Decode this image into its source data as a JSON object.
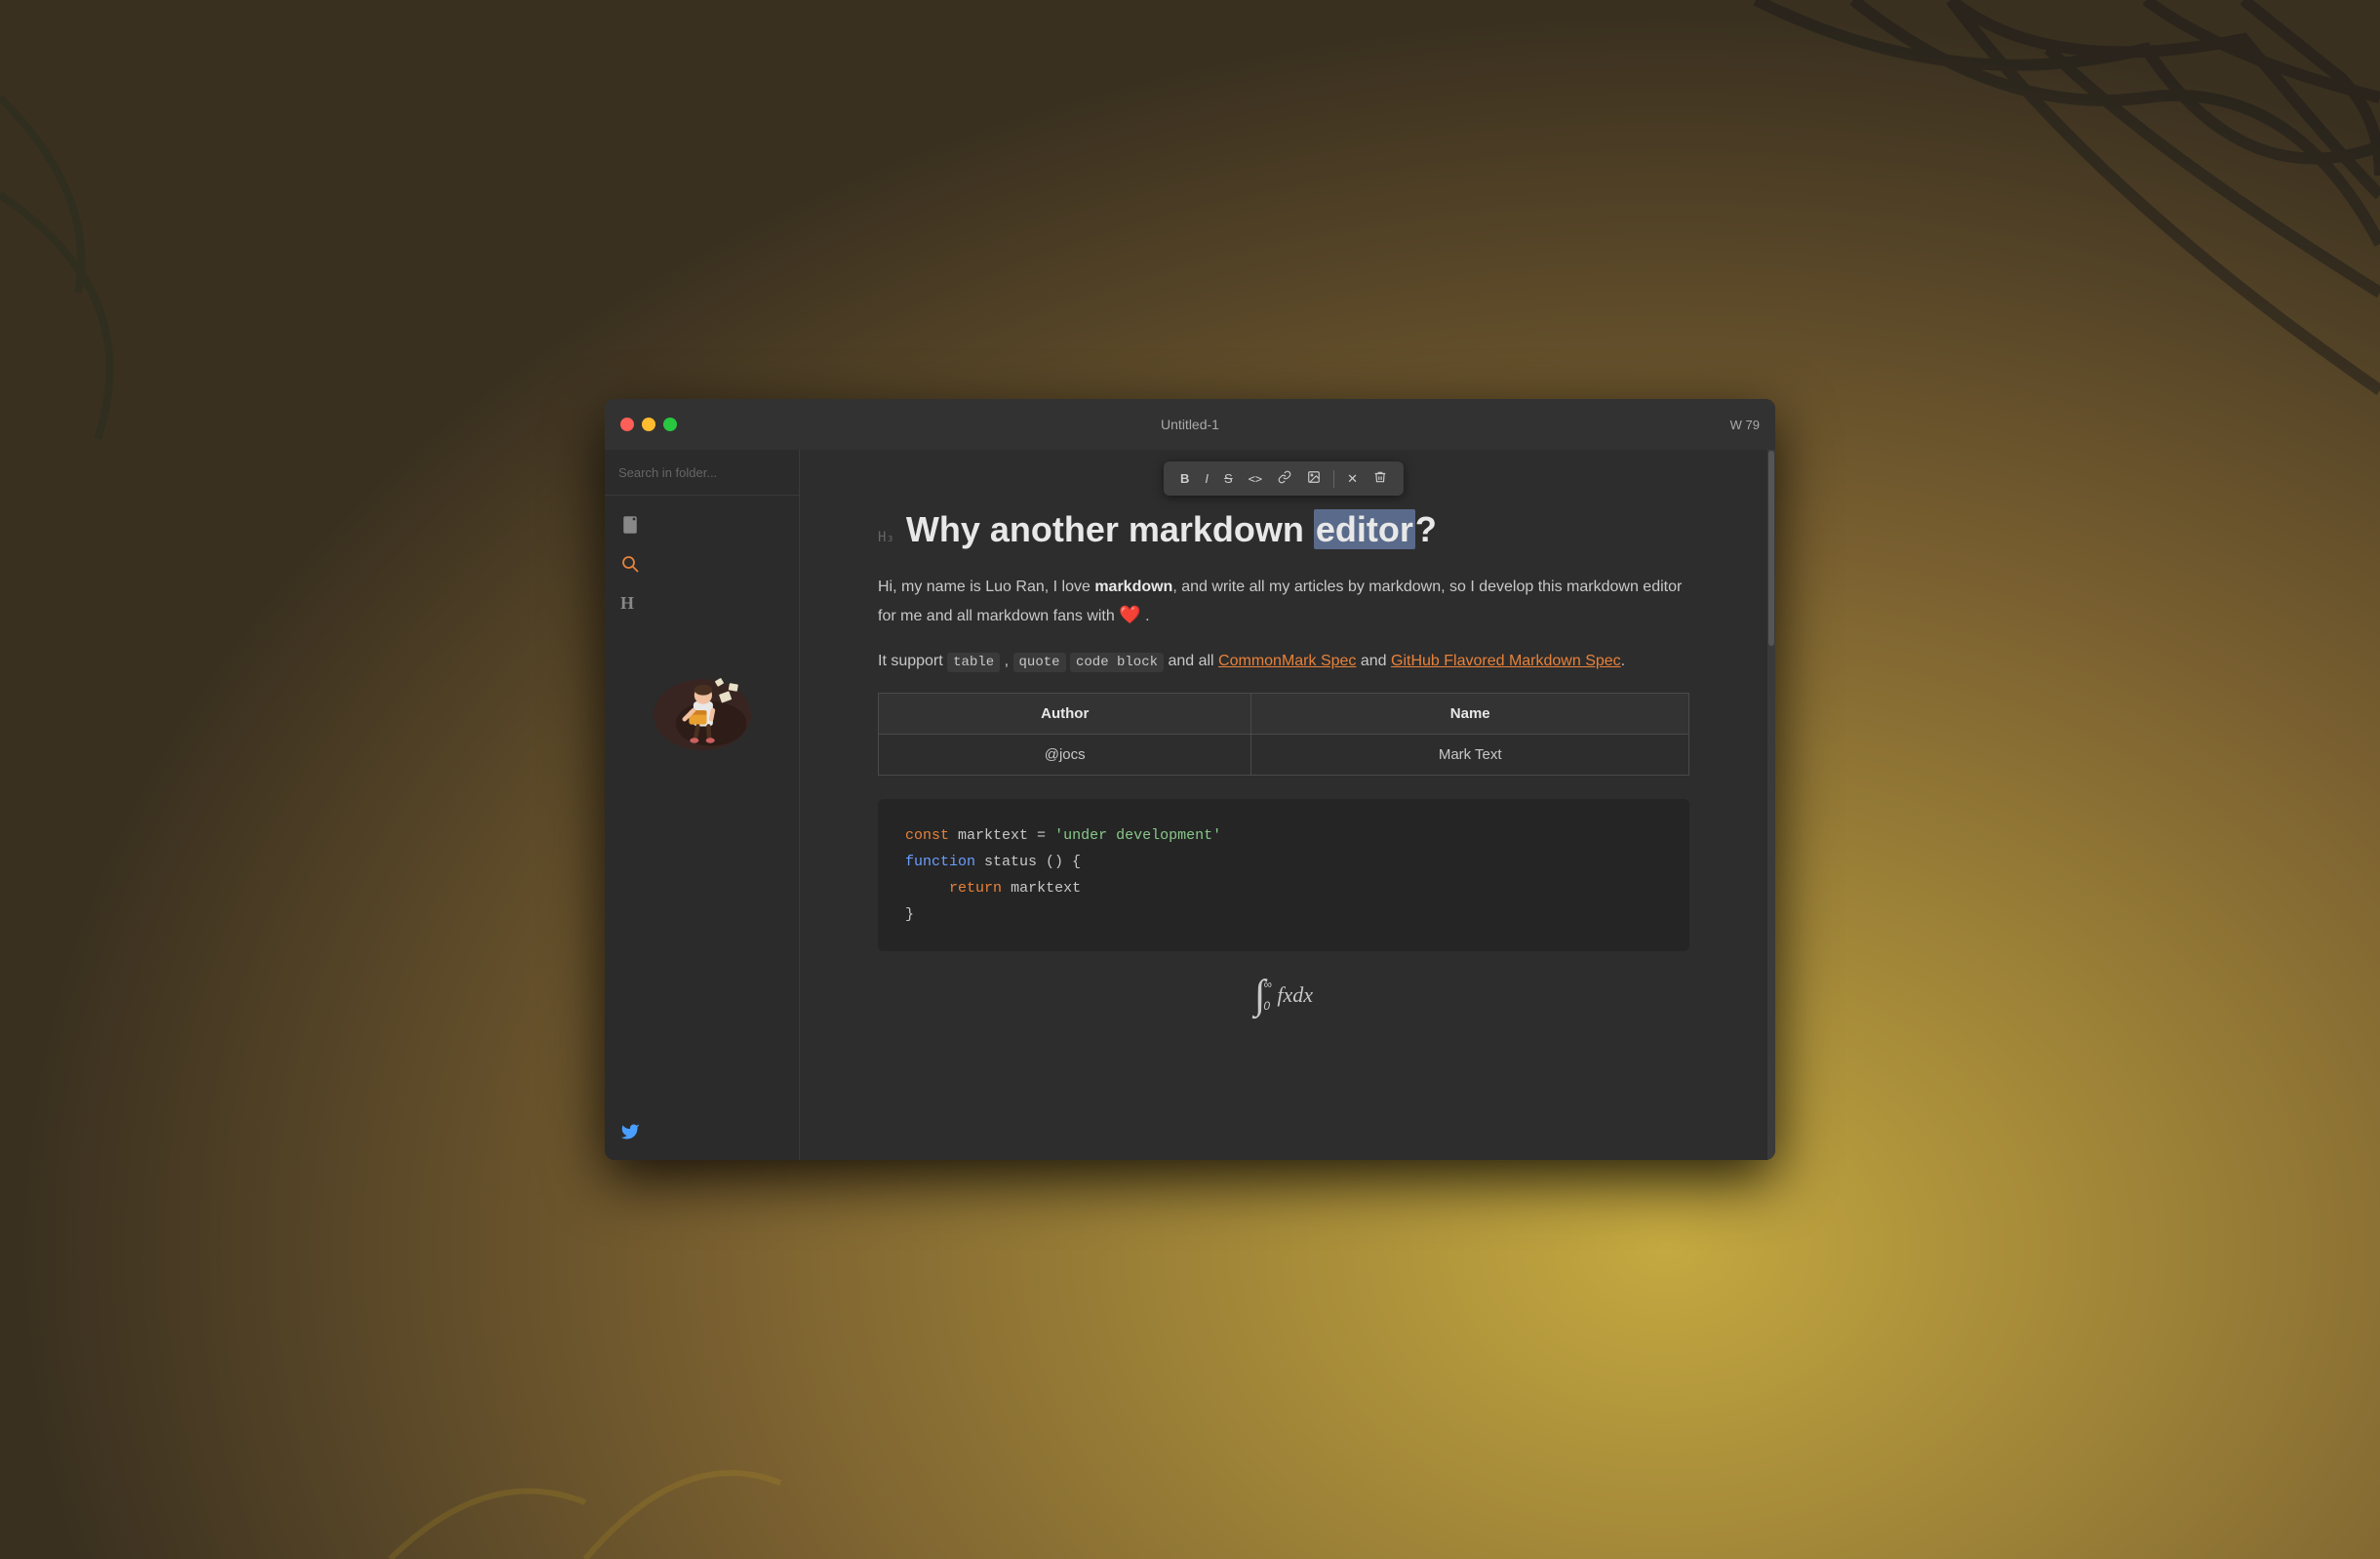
{
  "window": {
    "title": "Untitled-1",
    "word_count": "W 79",
    "traffic_lights": [
      "close",
      "minimize",
      "maximize"
    ]
  },
  "sidebar": {
    "search_placeholder": "Search in folder...",
    "nav_items": [
      {
        "id": "files",
        "icon": "📄",
        "label": "Files",
        "active": false
      },
      {
        "id": "search",
        "icon": "🔍",
        "label": "Search",
        "active": true
      },
      {
        "id": "headings",
        "icon": "H",
        "label": "Headings",
        "active": false
      }
    ],
    "twitter_icon": "🐦"
  },
  "toolbar": {
    "buttons": [
      {
        "id": "bold",
        "label": "B",
        "tooltip": "Bold"
      },
      {
        "id": "italic",
        "label": "I",
        "tooltip": "Italic"
      },
      {
        "id": "strikethrough",
        "label": "S̶",
        "tooltip": "Strikethrough"
      },
      {
        "id": "code-inline",
        "label": "<>",
        "tooltip": "Inline Code"
      },
      {
        "id": "link",
        "label": "🔗",
        "tooltip": "Link"
      },
      {
        "id": "image",
        "label": "🖼",
        "tooltip": "Image"
      },
      {
        "id": "remove",
        "label": "✕",
        "tooltip": "Remove"
      },
      {
        "id": "erase",
        "label": "◊",
        "tooltip": "Erase"
      }
    ]
  },
  "editor": {
    "heading_label": "H3",
    "heading_text_before": "Why another markdown ",
    "heading_selected": "editor",
    "heading_text_after": "?",
    "para1": "Hi, my name is Luo Ran, I love markdown, and write all my articles by markdown, so I develop this markdown editor for me and all markdown fans with ❤️ .",
    "para1_bold": "markdown",
    "para2_prefix": "It support",
    "para2_codes": [
      "table",
      "quote",
      "code block"
    ],
    "para2_middle": "and all",
    "para2_link1": "CommonMark Spec",
    "para2_link1_url": "#",
    "para2_and": "and",
    "para2_link2": "GitHub Flavored Markdown Spec",
    "para2_link2_url": "#",
    "table": {
      "headers": [
        "Author",
        "Name"
      ],
      "rows": [
        [
          "@jocs",
          "Mark Text"
        ]
      ]
    },
    "code_block": {
      "lines": [
        {
          "parts": [
            {
              "type": "keyword",
              "text": "const"
            },
            {
              "type": "normal",
              "text": " marktext = "
            },
            {
              "type": "string",
              "text": "'under development'"
            }
          ]
        },
        {
          "parts": [
            {
              "type": "keyword2",
              "text": "function"
            },
            {
              "type": "normal",
              "text": " status () {"
            }
          ]
        },
        {
          "parts": [
            {
              "type": "normal",
              "text": "    "
            },
            {
              "type": "return",
              "text": "return"
            },
            {
              "type": "normal",
              "text": " marktext"
            }
          ]
        },
        {
          "parts": [
            {
              "type": "normal",
              "text": "}"
            }
          ]
        }
      ]
    },
    "math": {
      "display": "∫₀^∞ fxdx"
    }
  }
}
